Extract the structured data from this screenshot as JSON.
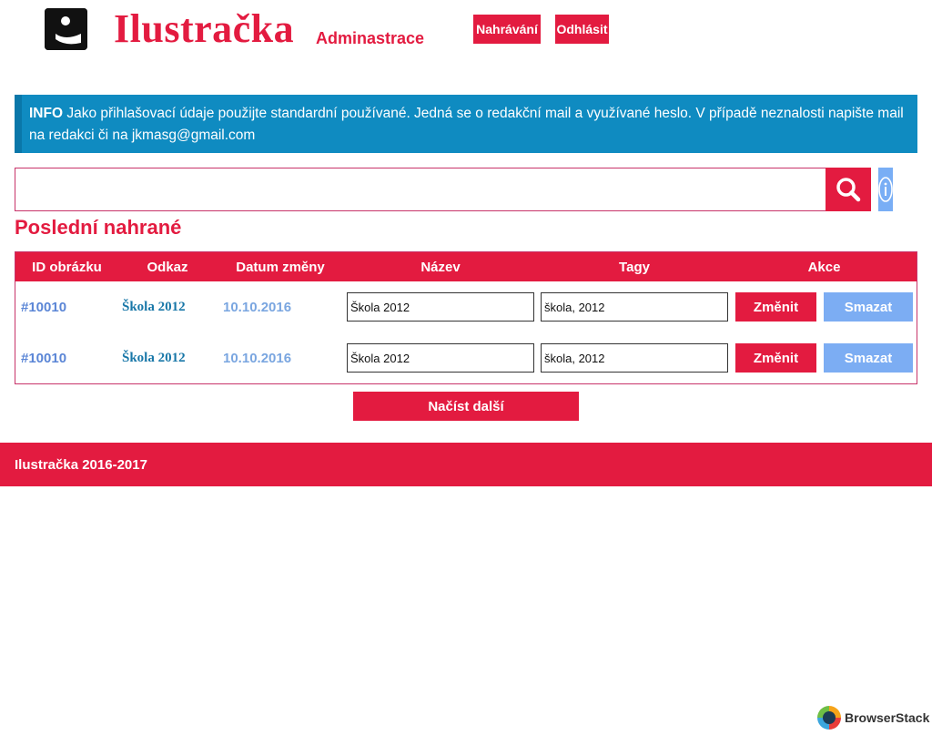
{
  "header": {
    "brand": "Ilustračka",
    "subtitle": "Adminastrace",
    "nav": {
      "upload_label": "Nahrávání",
      "logout_label": "Odhlásit"
    }
  },
  "info": {
    "label": "INFO",
    "text": "Jako přihlašovací údaje použijte standardní používané. Jedná se o redakční mail a využívané heslo. V případě neznalosti napište mail na redakci či na jkmasg@gmail.com"
  },
  "search": {
    "value": "",
    "placeholder": ""
  },
  "section_title": "Poslední nahrané",
  "table": {
    "headers": [
      "ID obrázku",
      "Odkaz",
      "Datum změny",
      "Název",
      "Tagy",
      "Akce"
    ],
    "rows": [
      {
        "id": "#10010",
        "link": "Škola 2012",
        "date": "10.10.2016",
        "name": "Škola 2012",
        "tags": "škola, 2012",
        "change_label": "Změnit",
        "delete_label": "Smazat"
      },
      {
        "id": "#10010",
        "link": "Škola 2012",
        "date": "10.10.2016",
        "name": "Škola 2012",
        "tags": "škola, 2012",
        "change_label": "Změnit",
        "delete_label": "Smazat"
      }
    ]
  },
  "load_more_label": "Načíst další",
  "footer": {
    "text": "Ilustračka 2016-2017"
  },
  "watermark": {
    "text": "BrowserStack"
  },
  "colors": {
    "accent": "#e31b40",
    "info": "#0f8bc1",
    "secondary": "#7cadf3"
  }
}
